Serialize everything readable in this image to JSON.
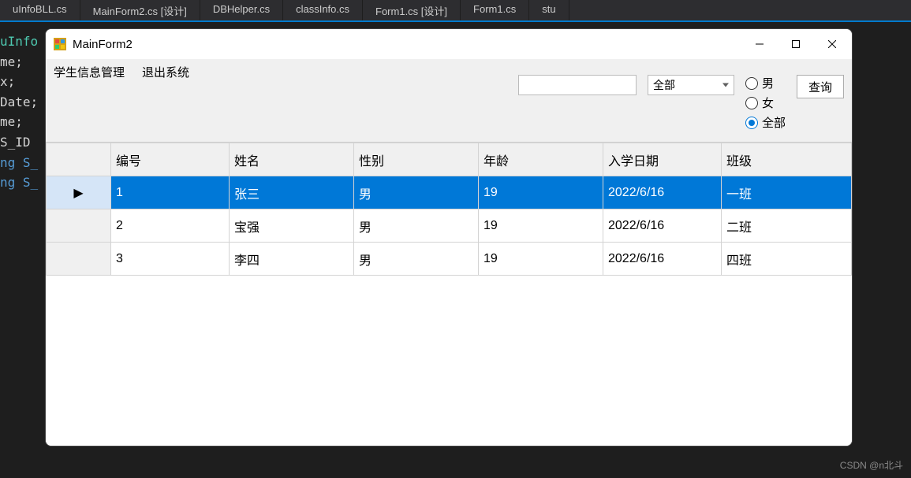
{
  "tabs": [
    {
      "label": "uInfoBLL.cs"
    },
    {
      "label": "MainForm2.cs [设计]"
    },
    {
      "label": "DBHelper.cs"
    },
    {
      "label": "classInfo.cs"
    },
    {
      "label": "Form1.cs [设计]"
    },
    {
      "label": "Form1.cs"
    },
    {
      "label": "stu"
    }
  ],
  "code_lines": [
    "",
    "uInfo",
    "",
    "",
    "",
    "me;",
    "x;",
    "",
    "Date;",
    "",
    "",
    "me;",
    "",
    "",
    "S_ID",
    "",
    "ng S_",
    "",
    "ng S_"
  ],
  "form": {
    "title": "MainForm2",
    "menu": {
      "item1": "学生信息管理",
      "item2": "退出系统"
    },
    "filters": {
      "textbox_value": "",
      "combobox_selected": "全部",
      "radio_male": "男",
      "radio_female": "女",
      "radio_all": "全部",
      "query_button": "查询"
    },
    "grid": {
      "columns": [
        "编号",
        "姓名",
        "性别",
        "年龄",
        "入学日期",
        "班级"
      ],
      "row_indicator": "▶",
      "rows": [
        {
          "selected": true,
          "cells": [
            "1",
            "张三",
            "男",
            "19",
            "2022/6/16",
            "一班"
          ]
        },
        {
          "selected": false,
          "cells": [
            "2",
            "宝强",
            "男",
            "19",
            "2022/6/16",
            "二班"
          ]
        },
        {
          "selected": false,
          "cells": [
            "3",
            "李四",
            "男",
            "19",
            "2022/6/16",
            "四班"
          ]
        }
      ]
    }
  },
  "watermark": "CSDN @n北斗"
}
